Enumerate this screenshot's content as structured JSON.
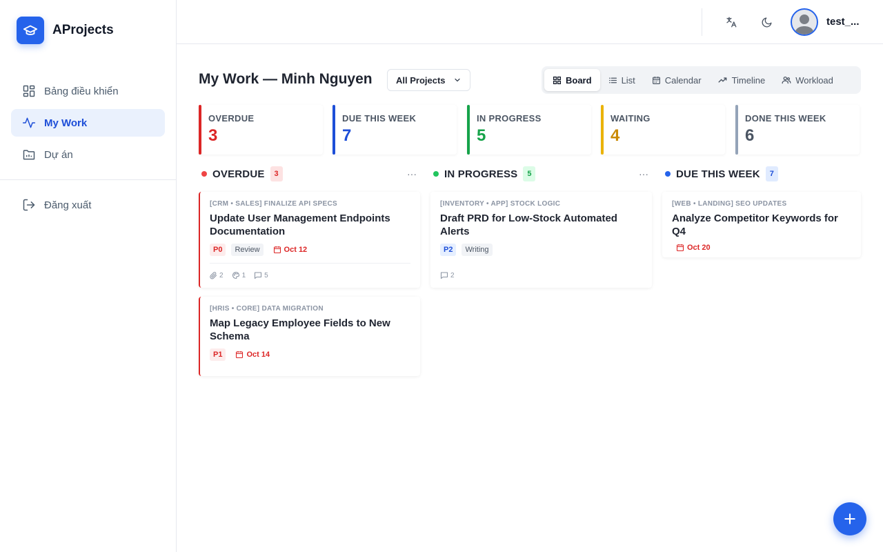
{
  "app": {
    "name": "AProjects"
  },
  "sidebar": {
    "items": [
      {
        "label": "Bảng điều khiển",
        "icon": "dashboard-icon",
        "active": false
      },
      {
        "label": "My Work",
        "icon": "activity-icon",
        "active": true
      },
      {
        "label": "Dự án",
        "icon": "folder-icon",
        "active": false
      }
    ],
    "logout": {
      "label": "Đăng xuất",
      "icon": "logout-icon"
    }
  },
  "header": {
    "translate_icon": "translate-icon",
    "theme_icon": "moon-icon",
    "username": "test_..."
  },
  "page": {
    "title": "My Work — Minh Nguyen",
    "project_filter": "All Projects"
  },
  "view_tabs": [
    {
      "label": "Board",
      "icon": "board-icon",
      "active": true
    },
    {
      "label": "List",
      "icon": "list-icon",
      "active": false
    },
    {
      "label": "Calendar",
      "icon": "calendar-icon",
      "active": false
    },
    {
      "label": "Timeline",
      "icon": "timeline-icon",
      "active": false
    },
    {
      "label": "Workload",
      "icon": "users-icon",
      "active": false
    }
  ],
  "stats": [
    {
      "label": "OVERDUE",
      "value": "3",
      "color": "#dc2626"
    },
    {
      "label": "DUE THIS WEEK",
      "value": "7",
      "color": "#1d4ed8"
    },
    {
      "label": "IN PROGRESS",
      "value": "5",
      "color": "#16a34a"
    },
    {
      "label": "WAITING",
      "value": "4",
      "color": "#ca8a04"
    },
    {
      "label": "DONE THIS WEEK",
      "value": "6",
      "color": "#4b5563"
    }
  ],
  "columns": [
    {
      "title": "OVERDUE",
      "count": "3",
      "dot_color": "#ef4444",
      "count_bg": "#fde2e2",
      "count_color": "#dc2626",
      "more": "···",
      "cards": [
        {
          "project": "[CRM • SALES] FINALIZE API SPECS",
          "title": "Update User Management Endpoints Documentation",
          "priority": "P0",
          "status": "Review",
          "due": "Oct 12",
          "attachments": "2",
          "links": "1",
          "comments": "5"
        },
        {
          "project": "[HRIS • CORE] DATA MIGRATION",
          "title": "Map Legacy Employee Fields to New Schema",
          "priority": "P1",
          "due": "Oct 14"
        }
      ]
    },
    {
      "title": "IN PROGRESS",
      "count": "5",
      "dot_color": "#22c55e",
      "count_bg": "#dcfce7",
      "count_color": "#16a34a",
      "more": "···",
      "cards": [
        {
          "project": "[INVENTORY • APP] STOCK LOGIC",
          "title": "Draft PRD for Low-Stock Automated Alerts",
          "priority": "P2",
          "status": "Writing",
          "comments": "2"
        }
      ]
    },
    {
      "title": "DUE THIS WEEK",
      "count": "7",
      "dot_color": "#2563eb",
      "count_bg": "#e0ebff",
      "count_color": "#1d4ed8",
      "cards": [
        {
          "project": "[WEB • LANDING] SEO UPDATES",
          "title": "Analyze Competitor Keywords for Q4",
          "due": "Oct 20"
        }
      ]
    }
  ],
  "fab": {
    "icon": "plus-icon"
  }
}
